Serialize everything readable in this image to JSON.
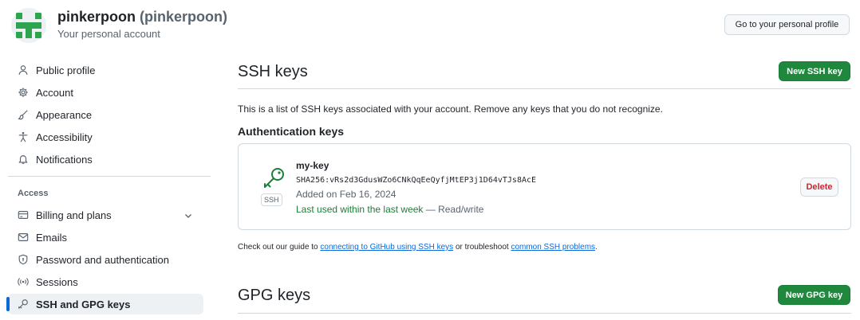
{
  "account": {
    "name": "pinkerpoon",
    "handle": "(pinkerpoon)",
    "subtitle": "Your personal account",
    "avatar_color": "#2da44e"
  },
  "header": {
    "profile_button": "Go to your personal profile"
  },
  "sidebar": {
    "items": [
      {
        "label": "Public profile",
        "icon": "person-icon"
      },
      {
        "label": "Account",
        "icon": "gear-icon"
      },
      {
        "label": "Appearance",
        "icon": "paintbrush-icon"
      },
      {
        "label": "Accessibility",
        "icon": "accessibility-icon"
      },
      {
        "label": "Notifications",
        "icon": "bell-icon"
      }
    ],
    "access_heading": "Access",
    "access_items": [
      {
        "label": "Billing and plans",
        "icon": "credit-card-icon"
      },
      {
        "label": "Emails",
        "icon": "mail-icon"
      },
      {
        "label": "Password and authentication",
        "icon": "shield-lock-icon"
      },
      {
        "label": "Sessions",
        "icon": "broadcast-icon"
      },
      {
        "label": "SSH and GPG keys",
        "icon": "key-icon"
      }
    ],
    "active_item": "SSH and GPG keys"
  },
  "ssh": {
    "title": "SSH keys",
    "new_button": "New SSH key",
    "description": "This is a list of SSH keys associated with your account. Remove any keys that you do not recognize.",
    "auth_heading": "Authentication keys",
    "key": {
      "badge": "SSH",
      "name": "my-key",
      "fingerprint": "SHA256:vRs2d3GdusWZo6CNkQqEeQyfjMtEP3j1D64vTJs8AcE",
      "added": "Added on Feb 16, 2024",
      "last_used": "Last used within the last week",
      "access": " — Read/write",
      "delete_button": "Delete"
    },
    "guide": {
      "prefix": "Check out our guide to ",
      "link1": "connecting to GitHub using SSH keys",
      "middle": " or troubleshoot ",
      "link2": "common SSH problems",
      "suffix": "."
    }
  },
  "gpg": {
    "title": "GPG keys",
    "new_button": "New GPG key"
  },
  "colors": {
    "primary_green": "#1f883d",
    "link_blue": "#0969da",
    "danger_red": "#d1242f",
    "success_green": "#1a7f37"
  }
}
